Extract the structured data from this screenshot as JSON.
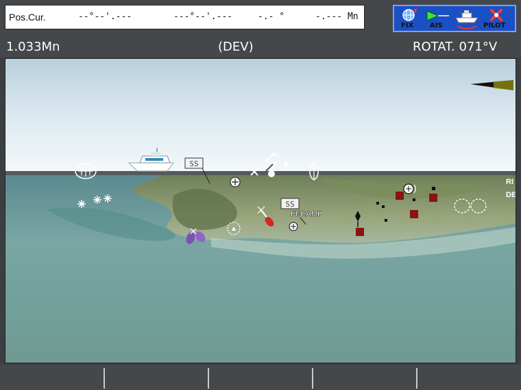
{
  "position": {
    "label": "Pos.Cur.",
    "lat": "--°--'.---",
    "lon": "---°--'.---",
    "bearing": "-.- °",
    "distance": "-.--- Mn"
  },
  "status_icons": {
    "fix": "FIX",
    "ais": "AIS",
    "pilot": "PILOT",
    "icons": [
      "globe-icon",
      "ais-triangle-icon",
      "boat-icon",
      "pilot-cross-icon"
    ]
  },
  "info_bar": {
    "range": "1.033Mn",
    "mode": "(DEV)",
    "heading": "ROTAT. 071°V"
  },
  "map": {
    "labels": {
      "ss_1": "SS",
      "ss_2": "SS",
      "fecamp": "FECAMP",
      "edge_1": "RI",
      "edge_2": "DE"
    },
    "colors": {
      "sky": "#dbe8f0",
      "sea": "#6f9c98",
      "land": "#8a9a6a",
      "marker_red": "#8b1212",
      "boat": "#ffffff"
    }
  },
  "softkeys": [
    "",
    "",
    "",
    "",
    ""
  ]
}
